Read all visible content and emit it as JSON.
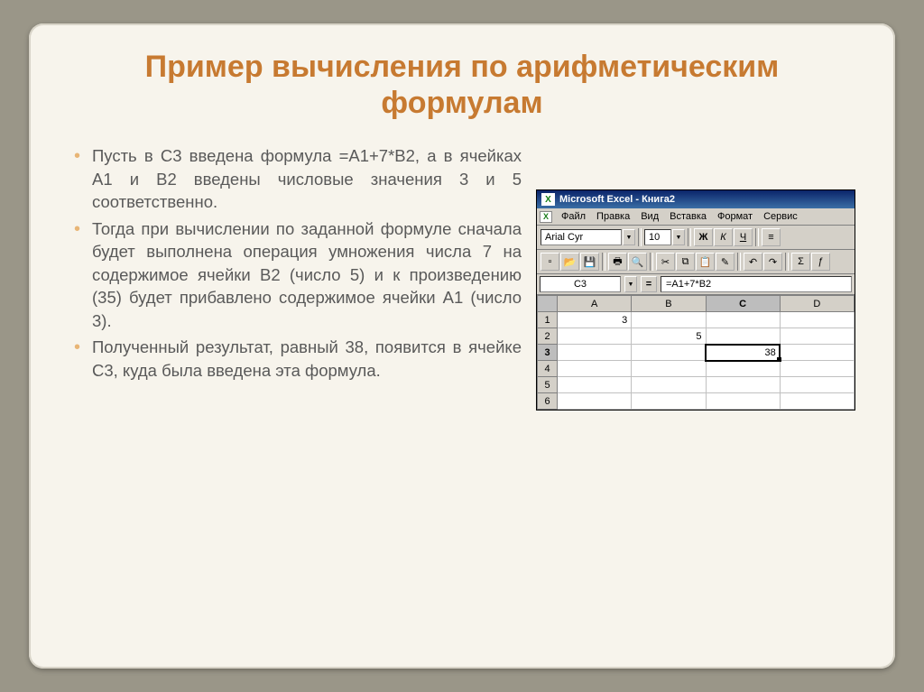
{
  "slide": {
    "title": "Пример вычисления по арифметическим формулам",
    "bullets": [
      "Пусть в C3 введена формула =A1+7*B2, а в ячейках A1 и B2 введены числовые значения 3 и 5 соответственно.",
      "Тогда при вычислении по заданной формуле сначала будет выполнена операция умножения числа 7 на содержимое ячейки B2 (число 5) и к произведению (35) будет прибавлено содержимое ячейки A1 (число 3).",
      "Полученный результат, равный 38, появится в ячейке C3, куда была введена эта формула."
    ]
  },
  "excel": {
    "title": "Microsoft Excel - Книга2",
    "menus": [
      "Файл",
      "Правка",
      "Вид",
      "Вставка",
      "Формат",
      "Сервис"
    ],
    "font_name": "Arial Cyr",
    "font_size": "10",
    "style_buttons": [
      "Ж",
      "К",
      "Ч"
    ],
    "name_box": "C3",
    "formula": "=A1+7*B2",
    "columns": [
      "A",
      "B",
      "C",
      "D"
    ],
    "rows": [
      1,
      2,
      3,
      4,
      5,
      6
    ],
    "cells": {
      "A1": "3",
      "B2": "5",
      "C3": "38"
    },
    "selected_cell": "C3"
  }
}
